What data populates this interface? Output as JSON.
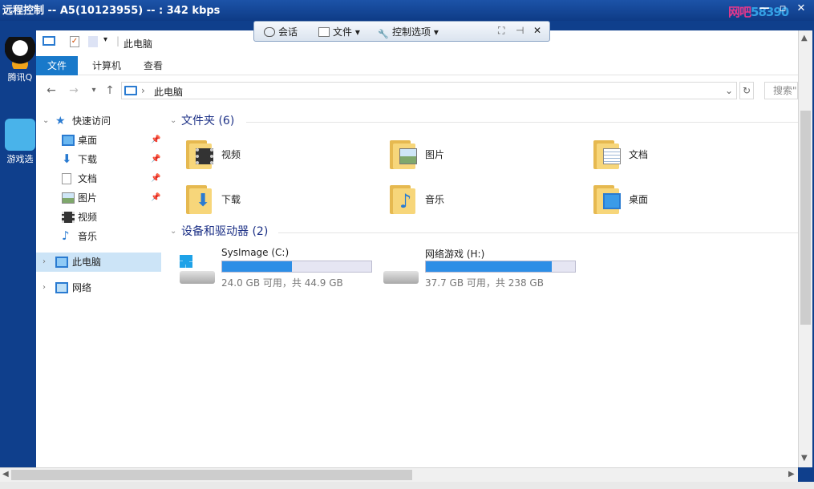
{
  "remote": {
    "title": "远程控制 -- A5(10123955) -- : 342 kbps",
    "brand_part1": "网吧",
    "brand_part2": "58390",
    "toolbar": {
      "session": "会话",
      "file": "文件",
      "control": "控制选项"
    }
  },
  "desktop": {
    "icons": [
      {
        "label": "腾讯Q"
      },
      {
        "label": "游戏选"
      }
    ]
  },
  "explorer": {
    "qat_title": "此电脑",
    "ribbon_tabs": [
      "文件",
      "计算机",
      "查看"
    ],
    "address_path": "此电脑",
    "search_placeholder": "搜索\"",
    "nav": {
      "quick_access": "快速访问",
      "quick_items": [
        "桌面",
        "下载",
        "文档",
        "图片",
        "视频",
        "音乐"
      ],
      "this_pc": "此电脑",
      "network": "网络"
    },
    "folders_header": "文件夹 (6)",
    "folders": [
      "视频",
      "图片",
      "文档",
      "下载",
      "音乐",
      "桌面"
    ],
    "devices_header": "设备和驱动器 (2)",
    "drives": [
      {
        "name": "SysImage (C:)",
        "free": "24.0 GB 可用，共 44.9 GB",
        "used_fraction": 0.466
      },
      {
        "name": "网络游戏 (H:)",
        "free": "37.7 GB 可用，共 238 GB",
        "used_fraction": 0.842
      }
    ]
  },
  "colors": {
    "accent": "#1979ca",
    "drive_bar": "#2d8ee6",
    "folder": "#f7d67a"
  }
}
